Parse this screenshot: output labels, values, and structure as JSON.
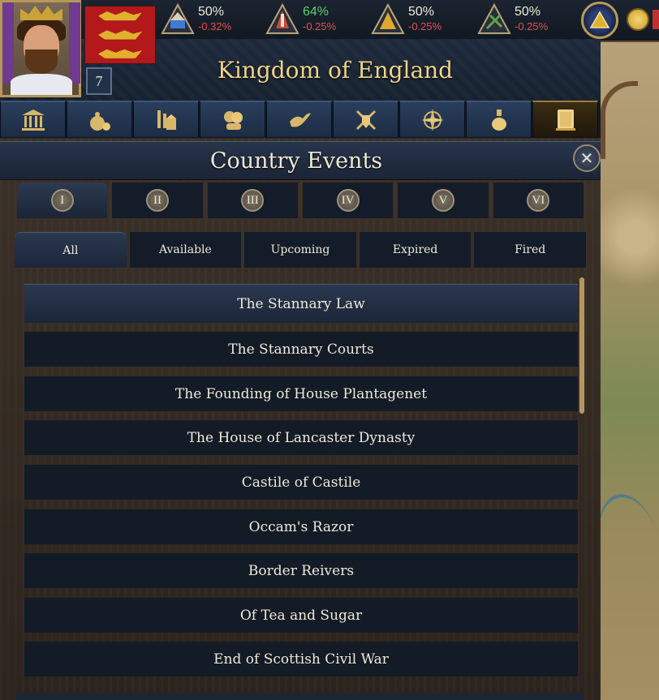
{
  "resources": [
    {
      "pct": "50%",
      "delta": "-0.32%",
      "icon": "clergy-estate-icon",
      "color": "#3f7bd6",
      "highlight": false
    },
    {
      "pct": "64%",
      "delta": "-0.25%",
      "icon": "nobility-estate-icon",
      "color": "#c84a3a",
      "highlight": true
    },
    {
      "pct": "50%",
      "delta": "-0.25%",
      "icon": "burghers-estate-icon",
      "color": "#e0a92c",
      "highlight": false
    },
    {
      "pct": "50%",
      "delta": "-0.25%",
      "icon": "peasants-estate-icon",
      "color": "#5aa84a",
      "highlight": false
    }
  ],
  "country": {
    "name": "Kingdom of England",
    "rank": "7"
  },
  "tabs": [
    {
      "icon": "government-icon"
    },
    {
      "icon": "economy-icon"
    },
    {
      "icon": "production-icon"
    },
    {
      "icon": "diplomacy-icon"
    },
    {
      "icon": "peace-dove-icon"
    },
    {
      "icon": "military-icon"
    },
    {
      "icon": "exploration-compass-icon"
    },
    {
      "icon": "technology-flask-icon"
    },
    {
      "icon": "events-book-icon",
      "active": true
    }
  ],
  "panel": {
    "title": "Country Events",
    "close_glyph": "✕"
  },
  "eras": [
    {
      "label": "I",
      "active": true
    },
    {
      "label": "II",
      "active": false
    },
    {
      "label": "III",
      "active": false
    },
    {
      "label": "IV",
      "active": false
    },
    {
      "label": "V",
      "active": false
    },
    {
      "label": "VI",
      "active": false
    }
  ],
  "filters": [
    {
      "label": "All",
      "active": true
    },
    {
      "label": "Available",
      "active": false
    },
    {
      "label": "Upcoming",
      "active": false
    },
    {
      "label": "Expired",
      "active": false
    },
    {
      "label": "Fired",
      "active": false
    }
  ],
  "events": [
    "The Stannary Law",
    "The Stannary Courts",
    "The Founding of House Plantagenet",
    "The House of Lancaster Dynasty",
    "Castile of Castile",
    "Occam's Razor",
    "Border Reivers",
    "Of Tea and Sugar",
    "End of Scottish Civil War"
  ],
  "colors": {
    "title_gold": "#f1d38a",
    "positive": "#5bd06a",
    "negative": "#e05050",
    "accent_gold": "#b69660"
  }
}
